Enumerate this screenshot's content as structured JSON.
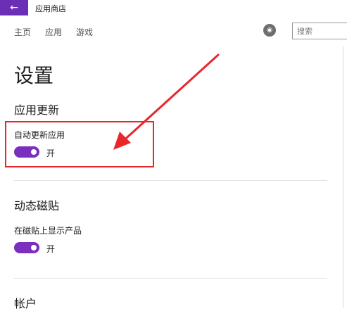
{
  "window": {
    "back_icon": "back-arrow-icon",
    "title": "应用商店",
    "accent": "#6b2fb5"
  },
  "nav": {
    "items": [
      "主页",
      "应用",
      "游戏"
    ]
  },
  "search": {
    "placeholder": "搜索",
    "value": ""
  },
  "page": {
    "title": "设置",
    "sections": [
      {
        "title": "应用更新",
        "setting_label": "自动更新应用",
        "toggle_state": "开",
        "toggle_on": true
      },
      {
        "title": "动态磁贴",
        "setting_label": "在磁贴上显示产品",
        "toggle_state": "开",
        "toggle_on": true
      },
      {
        "title": "帐户"
      }
    ]
  },
  "colors": {
    "toggle_on": "#7b2fbf",
    "annotation": "#e8262b"
  }
}
